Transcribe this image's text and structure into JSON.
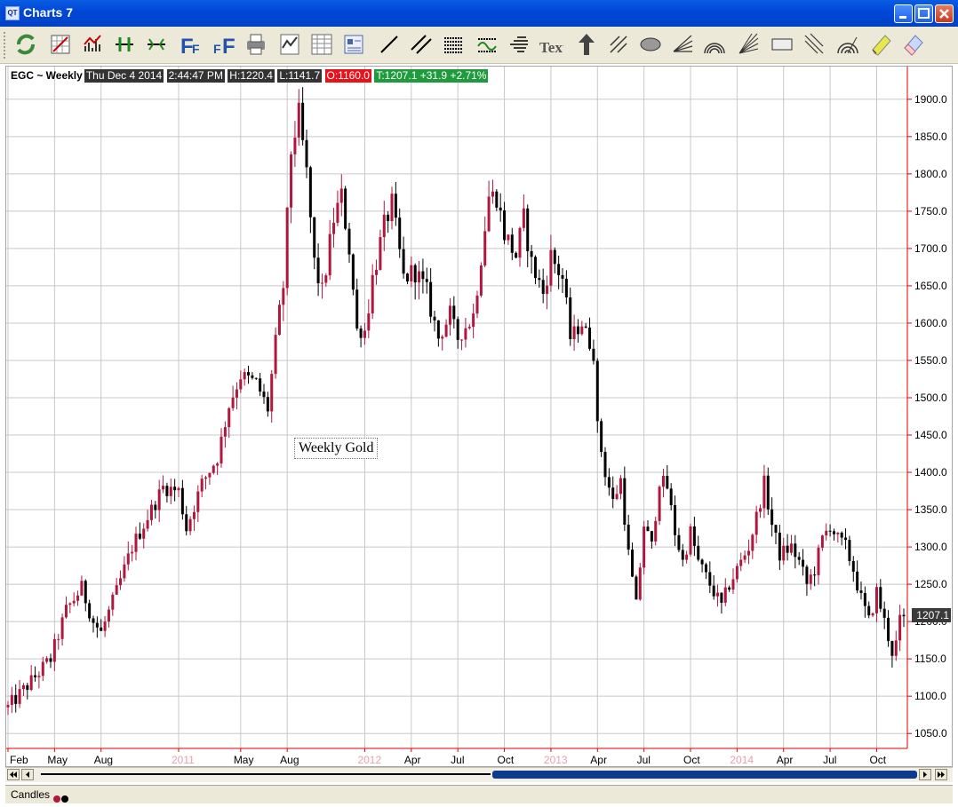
{
  "window": {
    "title": "Charts 7",
    "icon_text": "QT"
  },
  "toolbar": {
    "icons": [
      "refresh-icon",
      "grid-icon",
      "bar-chart-icon",
      "split-icon",
      "merge-icon",
      "font-icon",
      "font-small-icon",
      "print-icon",
      "chart-icon",
      "table-icon",
      "list-icon",
      "line-icon",
      "double-line-icon",
      "hlines-icon",
      "wave-icon",
      "stairs-icon",
      "text-icon",
      "arrow-up-icon",
      "cross-line-icon",
      "ellipse-icon",
      "fan-icon",
      "arcs-icon",
      "rays-icon",
      "rectangle-icon",
      "pitchfork-icon",
      "circles-icon",
      "highlighter-icon",
      "eraser-icon"
    ]
  },
  "header": {
    "symbol": "EGC ~ Weekly",
    "date": "Thu Dec 4 2014",
    "time": "2:44:47 PM",
    "high": "H:1220.4",
    "low": "L:1141.7",
    "open": "O:1160.0",
    "last": "T:1207.1",
    "change": "+31.9",
    "pct": "+2.71%"
  },
  "annotation": "Weekly Gold",
  "price_tag": "1207.1",
  "status": {
    "text": "Candles"
  },
  "colors": {
    "up": "#b0173d",
    "down": "#000000",
    "grid": "#c8c8c8",
    "axis": "#e00000",
    "year_label": "#e8a0b0"
  },
  "chart_data": {
    "type": "candlestick",
    "title": "Weekly Gold",
    "ylim": [
      1030,
      1920
    ],
    "y_ticks": [
      "1050.0",
      "1100.0",
      "1150.0",
      "1200.0",
      "1250.0",
      "1300.0",
      "1350.0",
      "1400.0",
      "1450.0",
      "1500.0",
      "1550.0",
      "1600.0",
      "1650.0",
      "1700.0",
      "1750.0",
      "1800.0",
      "1850.0",
      "1900.0"
    ],
    "x_labels": [
      {
        "label": "Feb",
        "week": 0,
        "year": false
      },
      {
        "label": "May",
        "week": 12,
        "year": false
      },
      {
        "label": "Aug",
        "week": 24,
        "year": false
      },
      {
        "label": "2011",
        "week": 44,
        "year": true
      },
      {
        "label": "May",
        "week": 60,
        "year": false
      },
      {
        "label": "Aug",
        "week": 72,
        "year": false
      },
      {
        "label": "2012",
        "week": 92,
        "year": true
      },
      {
        "label": "Apr",
        "week": 104,
        "year": false
      },
      {
        "label": "Jul",
        "week": 116,
        "year": false
      },
      {
        "label": "Oct",
        "week": 128,
        "year": false
      },
      {
        "label": "2013",
        "week": 140,
        "year": true
      },
      {
        "label": "Apr",
        "week": 152,
        "year": false
      },
      {
        "label": "Jul",
        "week": 164,
        "year": false
      },
      {
        "label": "Oct",
        "week": 176,
        "year": false
      },
      {
        "label": "2014",
        "week": 188,
        "year": true
      },
      {
        "label": "Apr",
        "week": 200,
        "year": false
      },
      {
        "label": "Jul",
        "week": 212,
        "year": false
      },
      {
        "label": "Oct",
        "week": 224,
        "year": false
      }
    ],
    "anchors": [
      [
        0,
        1085
      ],
      [
        6,
        1120
      ],
      [
        11,
        1150
      ],
      [
        15,
        1215
      ],
      [
        19,
        1245
      ],
      [
        22,
        1200
      ],
      [
        24,
        1185
      ],
      [
        28,
        1240
      ],
      [
        32,
        1300
      ],
      [
        36,
        1340
      ],
      [
        40,
        1380
      ],
      [
        44,
        1375
      ],
      [
        46,
        1325
      ],
      [
        50,
        1385
      ],
      [
        54,
        1420
      ],
      [
        57,
        1490
      ],
      [
        60,
        1530
      ],
      [
        64,
        1520
      ],
      [
        67,
        1485
      ],
      [
        69,
        1575
      ],
      [
        71,
        1650
      ],
      [
        73,
        1830
      ],
      [
        75,
        1880
      ],
      [
        77,
        1800
      ],
      [
        79,
        1680
      ],
      [
        81,
        1640
      ],
      [
        84,
        1740
      ],
      [
        86,
        1770
      ],
      [
        88,
        1700
      ],
      [
        90,
        1590
      ],
      [
        92,
        1590
      ],
      [
        94,
        1660
      ],
      [
        97,
        1730
      ],
      [
        99,
        1760
      ],
      [
        102,
        1660
      ],
      [
        105,
        1670
      ],
      [
        108,
        1640
      ],
      [
        111,
        1580
      ],
      [
        114,
        1610
      ],
      [
        116,
        1580
      ],
      [
        120,
        1610
      ],
      [
        122,
        1690
      ],
      [
        124,
        1770
      ],
      [
        126,
        1770
      ],
      [
        128,
        1720
      ],
      [
        131,
        1690
      ],
      [
        133,
        1740
      ],
      [
        135,
        1680
      ],
      [
        138,
        1640
      ],
      [
        140,
        1690
      ],
      [
        143,
        1660
      ],
      [
        145,
        1580
      ],
      [
        148,
        1600
      ],
      [
        151,
        1560
      ],
      [
        152,
        1460
      ],
      [
        154,
        1400
      ],
      [
        156,
        1360
      ],
      [
        158,
        1390
      ],
      [
        160,
        1290
      ],
      [
        162,
        1220
      ],
      [
        164,
        1330
      ],
      [
        166,
        1300
      ],
      [
        168,
        1390
      ],
      [
        170,
        1380
      ],
      [
        172,
        1320
      ],
      [
        174,
        1280
      ],
      [
        176,
        1320
      ],
      [
        178,
        1280
      ],
      [
        180,
        1260
      ],
      [
        182,
        1240
      ],
      [
        184,
        1220
      ],
      [
        186,
        1250
      ],
      [
        188,
        1270
      ],
      [
        191,
        1300
      ],
      [
        193,
        1340
      ],
      [
        195,
        1385
      ],
      [
        197,
        1330
      ],
      [
        199,
        1290
      ],
      [
        202,
        1300
      ],
      [
        204,
        1280
      ],
      [
        206,
        1250
      ],
      [
        208,
        1270
      ],
      [
        210,
        1310
      ],
      [
        212,
        1330
      ],
      [
        214,
        1310
      ],
      [
        216,
        1300
      ],
      [
        218,
        1270
      ],
      [
        220,
        1230
      ],
      [
        222,
        1200
      ],
      [
        224,
        1240
      ],
      [
        226,
        1200
      ],
      [
        228,
        1160
      ],
      [
        229,
        1170
      ],
      [
        230,
        1200
      ],
      [
        231,
        1207
      ]
    ]
  }
}
